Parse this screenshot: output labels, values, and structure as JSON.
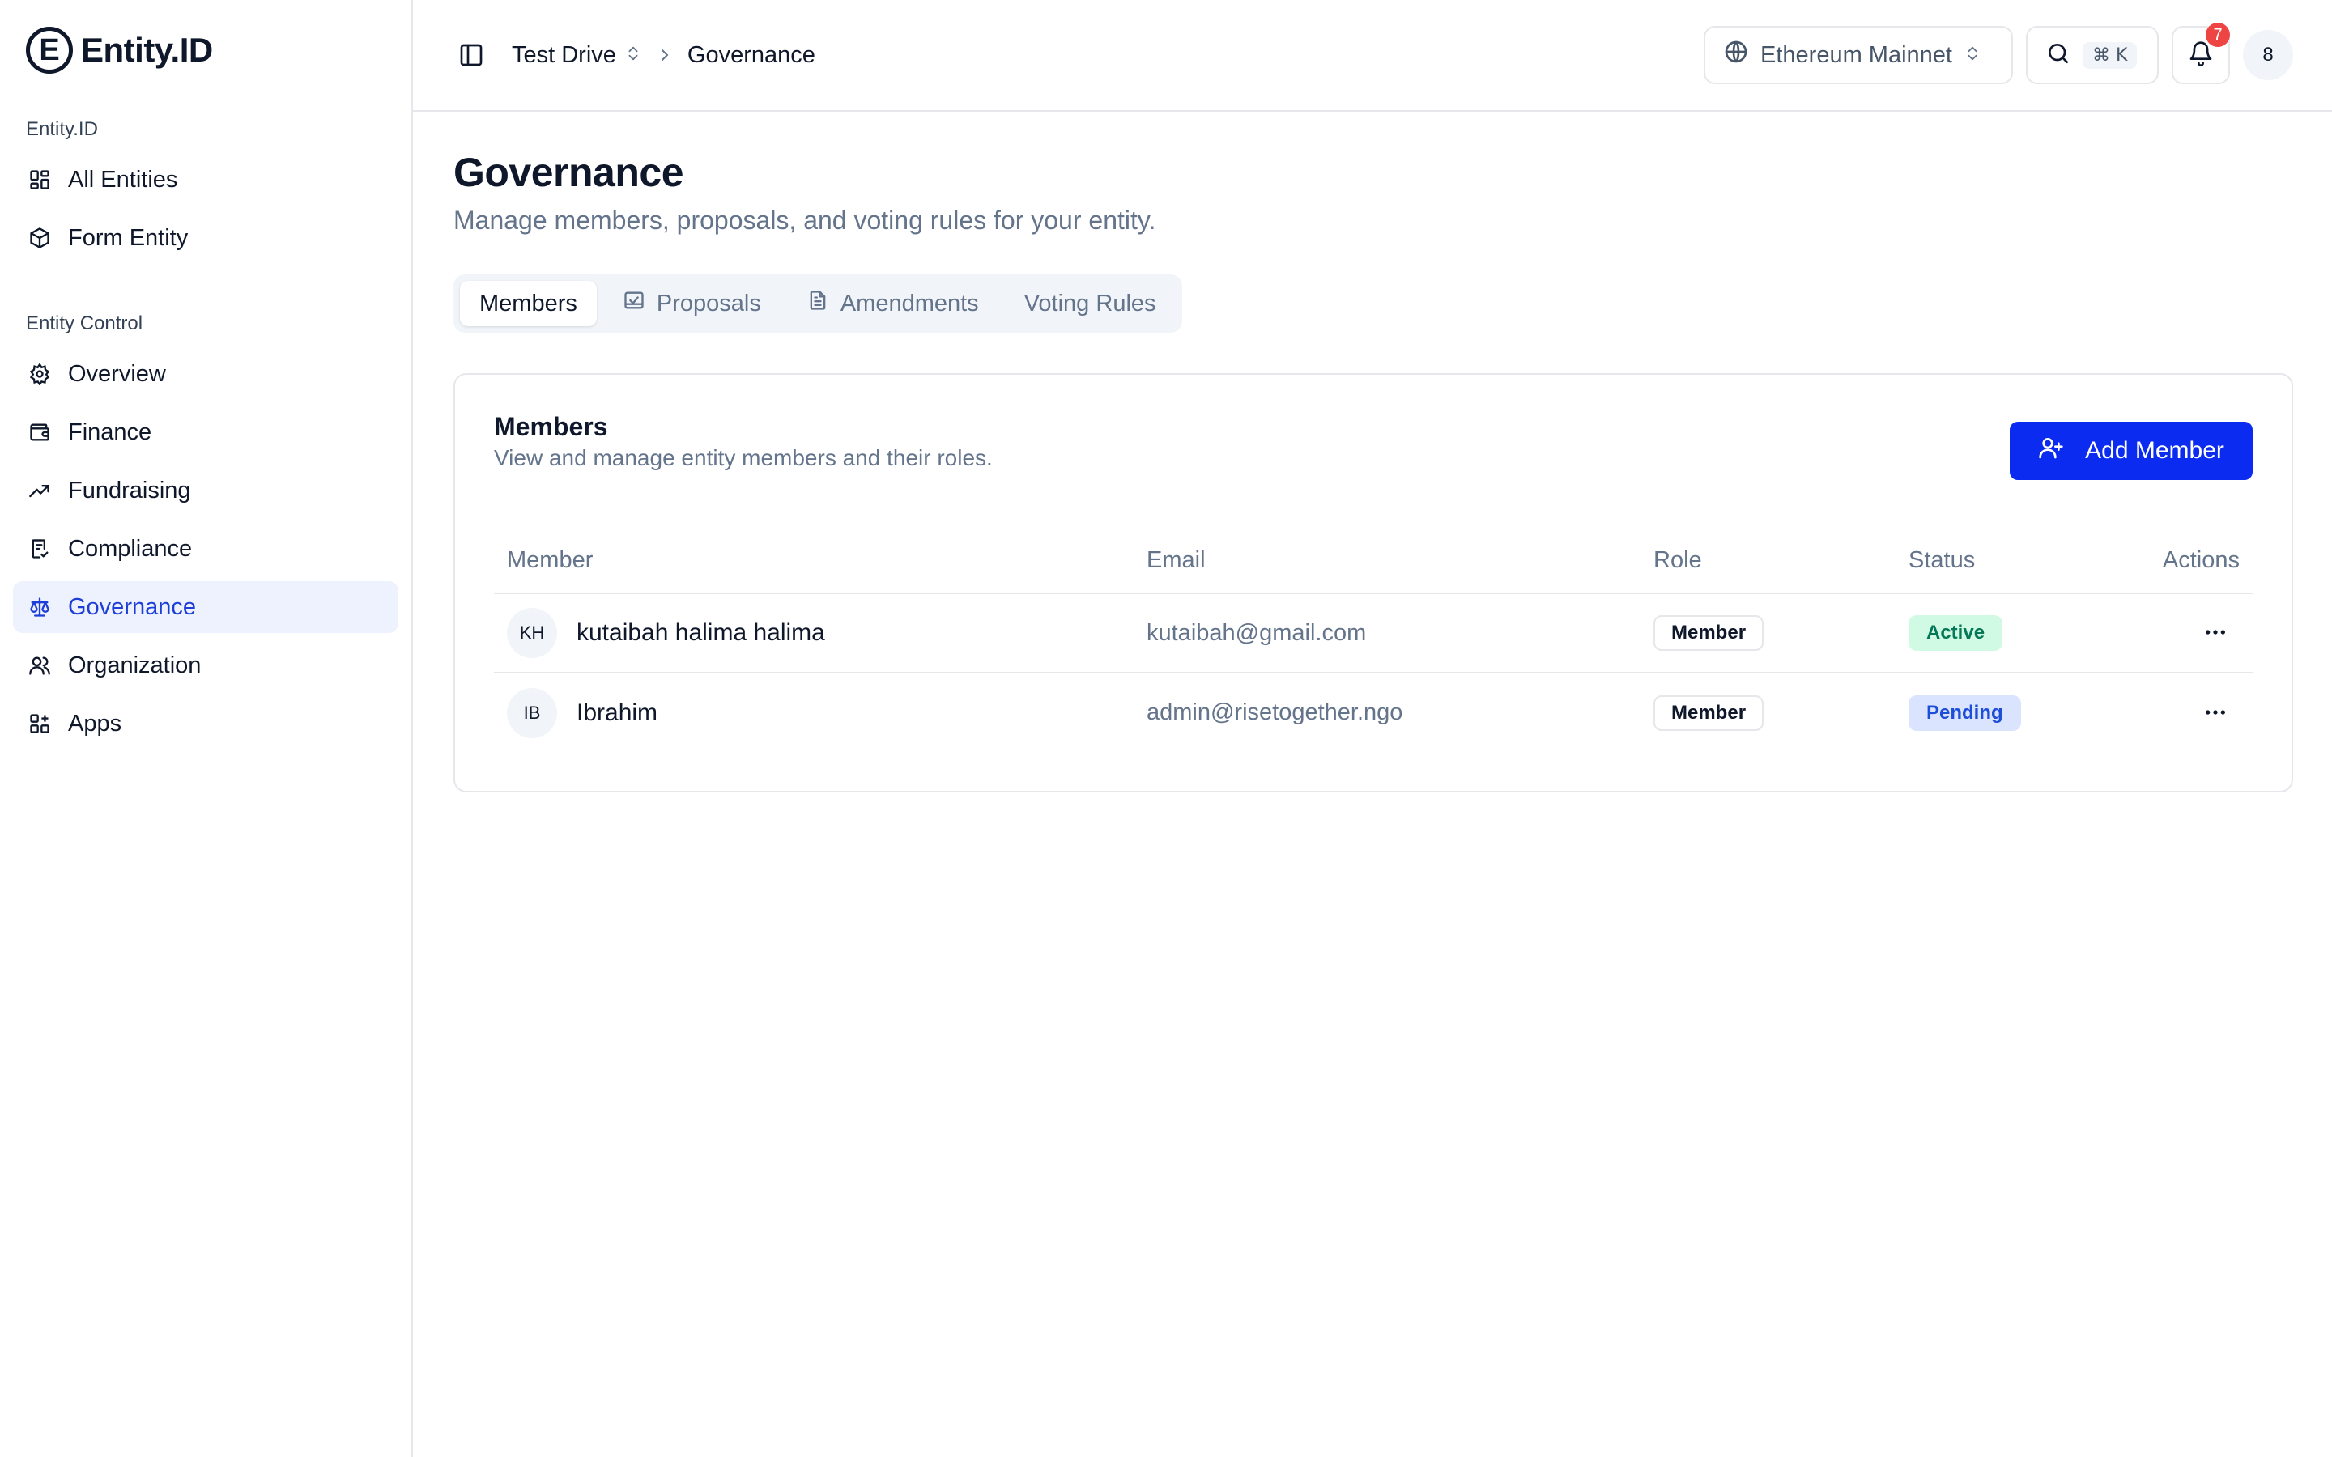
{
  "brand": {
    "logo_letter": "E",
    "name": "Entity.ID"
  },
  "sidebar": {
    "sections": [
      {
        "label": "Entity.ID",
        "items": [
          {
            "label": "All Entities",
            "icon": "grid-icon"
          },
          {
            "label": "Form Entity",
            "icon": "package-icon"
          }
        ]
      },
      {
        "label": "Entity Control",
        "items": [
          {
            "label": "Overview",
            "icon": "gear-icon"
          },
          {
            "label": "Finance",
            "icon": "wallet-icon"
          },
          {
            "label": "Fundraising",
            "icon": "trending-up-icon"
          },
          {
            "label": "Compliance",
            "icon": "file-check-icon"
          },
          {
            "label": "Governance",
            "icon": "scale-icon",
            "active": true
          },
          {
            "label": "Organization",
            "icon": "users-icon"
          },
          {
            "label": "Apps",
            "icon": "apps-icon"
          }
        ]
      }
    ]
  },
  "topbar": {
    "breadcrumb": {
      "entity": "Test Drive",
      "page": "Governance"
    },
    "network": "Ethereum Mainnet",
    "search_shortcut": "⌘ K",
    "notifications_count": "7",
    "avatar_label": "8"
  },
  "page": {
    "title": "Governance",
    "subtitle": "Manage members, proposals, and voting rules for your entity."
  },
  "tabs": [
    {
      "label": "Members",
      "active": true
    },
    {
      "label": "Proposals"
    },
    {
      "label": "Amendments"
    },
    {
      "label": "Voting Rules"
    }
  ],
  "members_card": {
    "title": "Members",
    "description": "View and manage entity members and their roles.",
    "add_button": "Add Member",
    "columns": [
      "Member",
      "Email",
      "Role",
      "Status",
      "Actions"
    ],
    "rows": [
      {
        "initials": "KH",
        "name": "kutaibah halima halima",
        "email": "kutaibah@gmail.com",
        "role": "Member",
        "status": "Active"
      },
      {
        "initials": "IB",
        "name": "Ibrahim",
        "email": "admin@risetogether.ngo",
        "role": "Member",
        "status": "Pending"
      }
    ]
  },
  "colors": {
    "accent": "#0b2cf0",
    "active_nav_bg": "#eef1fe",
    "active_nav_text": "#1d3fd8",
    "status_active_bg": "#d1fae5",
    "status_pending_bg": "#dbe4ff",
    "notification_badge": "#ef4444"
  }
}
